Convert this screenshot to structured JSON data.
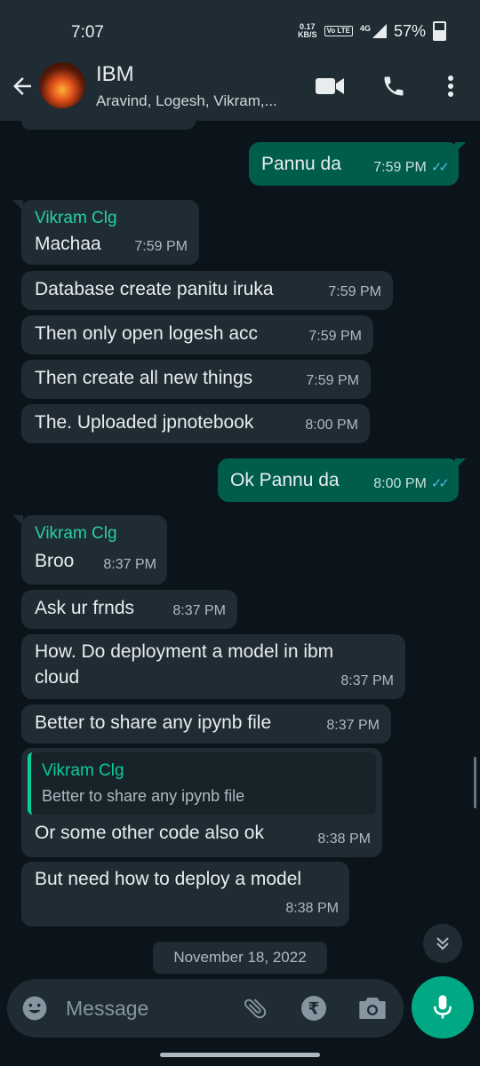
{
  "status_bar": {
    "time": "7:07",
    "speed_value": "0.17",
    "speed_unit": "KB/S",
    "volte": "Vo LTE",
    "network": "4G",
    "battery": "57%"
  },
  "header": {
    "group_name": "IBM",
    "participants": "Aravind, Logesh, Vikram,..."
  },
  "messages": [
    {
      "text": "Pannu da",
      "time": "7:59 PM"
    },
    {
      "sender": "Vikram Clg",
      "text": "Machaa",
      "time": "7:59 PM"
    },
    {
      "text": "Database create panitu iruka",
      "time": "7:59 PM"
    },
    {
      "text": "Then only open logesh acc",
      "time": "7:59 PM"
    },
    {
      "text": "Then create all new things",
      "time": "7:59 PM"
    },
    {
      "text": "The. Uploaded jpnotebook",
      "time": "8:00 PM"
    },
    {
      "text": "Ok Pannu da",
      "time": "8:00 PM"
    },
    {
      "sender": "Vikram Clg",
      "text": "Broo",
      "time": "8:37 PM"
    },
    {
      "text": "Ask ur frnds",
      "time": "8:37 PM"
    },
    {
      "text_line1": "How. Do deployment a model in ibm",
      "text_line2": "cloud",
      "time": "8:37 PM"
    },
    {
      "text": "Better to share any ipynb file",
      "time": "8:37 PM"
    },
    {
      "quote_sender": "Vikram Clg",
      "quote_text": "Better to share any ipynb file",
      "text": "Or some other code also ok",
      "time": "8:38 PM"
    },
    {
      "text": "But need how to deploy a model",
      "time": "8:38 PM"
    }
  ],
  "date_chip": "November 18, 2022",
  "composer": {
    "placeholder": "Message"
  },
  "colors": {
    "background": "#0b141a",
    "incoming_bubble": "#1f2c34",
    "outgoing_bubble": "#005c4b",
    "accent": "#00a884",
    "read_tick": "#53bdeb"
  }
}
